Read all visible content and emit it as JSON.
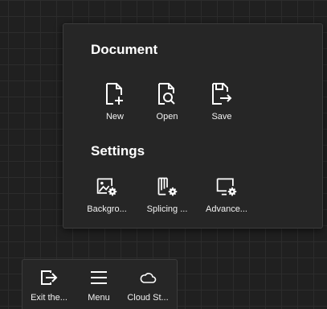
{
  "panel": {
    "document_title": "Document",
    "settings_title": "Settings",
    "document_items": [
      {
        "label": "New",
        "icon": "new-file-icon"
      },
      {
        "label": "Open",
        "icon": "open-file-icon"
      },
      {
        "label": "Save",
        "icon": "save-file-icon"
      }
    ],
    "settings_items": [
      {
        "label": "Backgro...",
        "icon": "background-settings-icon"
      },
      {
        "label": "Splicing ...",
        "icon": "splicing-settings-icon"
      },
      {
        "label": "Advance...",
        "icon": "advanced-settings-icon"
      }
    ]
  },
  "toolbar": {
    "items": [
      {
        "label": "Exit the...",
        "icon": "exit-icon"
      },
      {
        "label": "Menu",
        "icon": "menu-icon"
      },
      {
        "label": "Cloud St...",
        "icon": "cloud-icon"
      }
    ]
  },
  "colors": {
    "background": "#202020",
    "panel": "#262626",
    "text": "#ffffff"
  }
}
